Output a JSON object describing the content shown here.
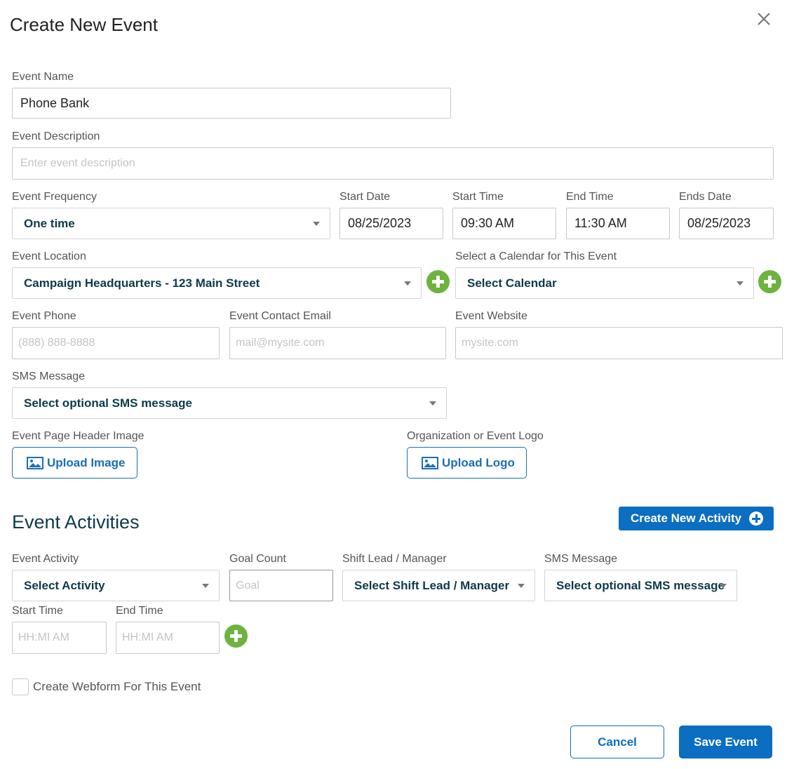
{
  "dialog": {
    "title": "Create New Event",
    "close_icon": "close-icon"
  },
  "form": {
    "event_name": {
      "label": "Event Name",
      "value": "Phone Bank"
    },
    "event_description": {
      "label": "Event Description",
      "placeholder": "Enter event description"
    },
    "event_frequency": {
      "label": "Event Frequency",
      "value": "One time"
    },
    "start_date": {
      "label": "Start Date",
      "value": "08/25/2023"
    },
    "start_time": {
      "label": "Start Time",
      "value": "09:30 AM"
    },
    "end_time": {
      "label": "End Time",
      "value": "11:30 AM"
    },
    "ends_date": {
      "label": "Ends Date",
      "value": "08/25/2023"
    },
    "event_location": {
      "label": "Event Location",
      "value": "Campaign Headquarters - 123 Main Street"
    },
    "calendar": {
      "label": "Select a Calendar for This Event",
      "value": "Select Calendar"
    },
    "event_phone": {
      "label": "Event Phone",
      "placeholder": "(888) 888-8888"
    },
    "contact_email": {
      "label": "Event Contact Email",
      "placeholder": "mail@mysite.com"
    },
    "event_website": {
      "label": "Event Website",
      "placeholder": "mysite.com"
    },
    "sms_message": {
      "label": "SMS Message",
      "value": "Select optional SMS message"
    },
    "header_image": {
      "label": "Event Page Header Image",
      "button": "Upload Image"
    },
    "logo": {
      "label": "Organization or Event Logo",
      "button": "Upload Logo"
    }
  },
  "activities": {
    "title": "Event Activities",
    "create_button": "Create New Activity",
    "event_activity": {
      "label": "Event Activity",
      "value": "Select Activity"
    },
    "goal_count": {
      "label": "Goal Count",
      "placeholder": "Goal"
    },
    "shift_lead": {
      "label": "Shift Lead / Manager",
      "value": "Select Shift Lead / Manager"
    },
    "sms_message": {
      "label": "SMS Message",
      "value": "Select optional SMS message"
    },
    "start_time": {
      "label": "Start Time",
      "placeholder": "HH:MI AM"
    },
    "end_time": {
      "label": "End Time",
      "placeholder": "HH:MI AM"
    }
  },
  "webform": {
    "label": "Create Webform For This Event",
    "checked": false
  },
  "footer": {
    "cancel": "Cancel",
    "save": "Save Event"
  },
  "colors": {
    "primary": "#0b6ec1",
    "add_green": "#6db33f",
    "select_text": "#0d3a4a"
  }
}
